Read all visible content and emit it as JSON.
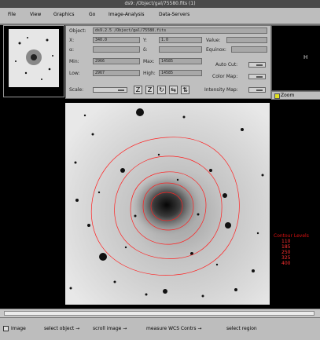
{
  "window": {
    "title": "ds9: /Object/gal/75580.fits (1)"
  },
  "menubar": {
    "items": [
      "File",
      "View",
      "Graphics",
      "Go",
      "Image-Analysis",
      "Data-Servers"
    ]
  },
  "panel": {
    "object_label": "Object:",
    "object_value": "ds9.2.5 /Object/gal/75580.fits",
    "x_label": "X:",
    "x_value": "340.0",
    "y_label": "Y:",
    "y_value": "1.0",
    "value_label": "Value:",
    "alpha_label": "α:",
    "delta_label": "δ:",
    "equinox_label": "Equinox:",
    "min_label": "Min:",
    "min_value": "2966",
    "max_label": "Max:",
    "max_value": "14585",
    "low_label": "Low:",
    "low_value": "2967",
    "high_label": "High:",
    "high_value": "14585",
    "autocut_label": "Auto Cut:",
    "colormap_label": "Color Map:",
    "scale_label": "Scale:",
    "intensity_label": "Intensity Map:",
    "zoom_in_button": "Z",
    "zoom_out_button": "Z",
    "rotate_button": "↻",
    "pan_button": "⇆",
    "flip_button": "⇅"
  },
  "magnifier": {
    "marker": "H"
  },
  "zoom": {
    "label": "Zoom"
  },
  "legend": {
    "title": "Contour Levels",
    "levels": [
      "110",
      "185",
      "250",
      "325",
      "400"
    ]
  },
  "status": {
    "items": [
      "Image",
      "select object →",
      "scroll image →",
      "measure WCS Contrs →",
      "select region"
    ]
  },
  "colors": {
    "contour": "#ff2020",
    "panel": "#bfbfbf",
    "background": "#000000"
  }
}
